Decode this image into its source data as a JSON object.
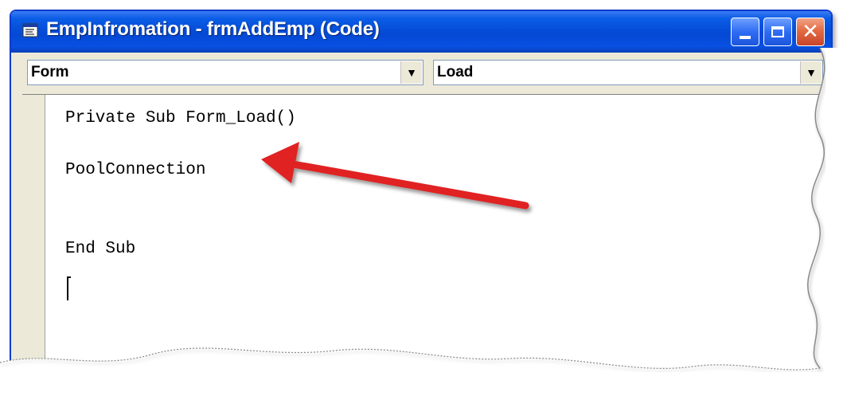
{
  "window": {
    "title": "EmpInfromation - frmAddEmp (Code)"
  },
  "titlebar_buttons": [
    "minimize-icon",
    "maximize-icon",
    "close-icon"
  ],
  "combos": {
    "object": "Form",
    "procedure": "Load"
  },
  "code": {
    "lines": [
      "Private Sub Form_Load()",
      "PoolConnection",
      "End Sub"
    ]
  },
  "annotation": {
    "arrow_color": "#e02020"
  }
}
